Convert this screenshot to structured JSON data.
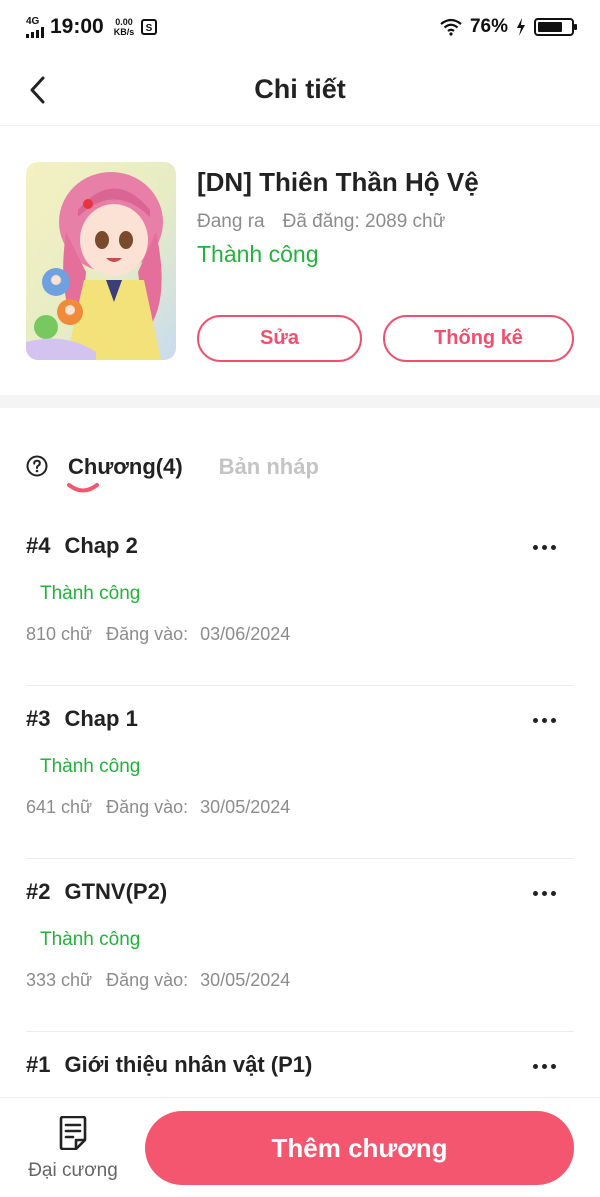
{
  "status_bar": {
    "network": "4G",
    "time": "19:00",
    "speed_value": "0.00",
    "speed_unit": "KB/s",
    "battery": "76%",
    "battery_level": 0.76
  },
  "header": {
    "title": "Chi tiết"
  },
  "story": {
    "title": "[DN] Thiên Thần Hộ Vệ",
    "state": "Đang ra",
    "word_count": "Đã đăng: 2089 chữ",
    "status": "Thành công",
    "edit_label": "Sửa",
    "stats_label": "Thống kê"
  },
  "tabs": {
    "chapters_label": "Chương(4)",
    "drafts_label": "Bản nháp"
  },
  "chapters": [
    {
      "number": "#4",
      "title": "Chap 2",
      "status": "Thành công",
      "words": "810 chữ",
      "posted_label": "Đăng vào:",
      "date": "03/06/2024"
    },
    {
      "number": "#3",
      "title": "Chap 1",
      "status": "Thành công",
      "words": "641 chữ",
      "posted_label": "Đăng vào:",
      "date": "30/05/2024"
    },
    {
      "number": "#2",
      "title": "GTNV(P2)",
      "status": "Thành công",
      "words": "333 chữ",
      "posted_label": "Đăng vào:",
      "date": "30/05/2024"
    },
    {
      "number": "#1",
      "title": "Giới thiệu nhân vật (P1)"
    }
  ],
  "bottom_bar": {
    "outline_label": "Đại cương",
    "add_chapter_label": "Thêm chương"
  },
  "colors": {
    "accent": "#f4566f",
    "success": "#23b23a",
    "muted": "#8c8c8c"
  }
}
